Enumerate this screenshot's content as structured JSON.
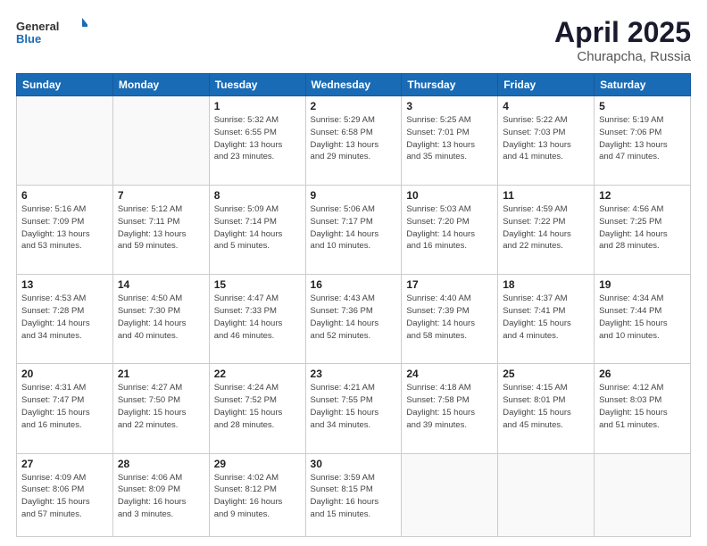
{
  "header": {
    "logo_general": "General",
    "logo_blue": "Blue",
    "title": "April 2025",
    "location": "Churapcha, Russia"
  },
  "weekdays": [
    "Sunday",
    "Monday",
    "Tuesday",
    "Wednesday",
    "Thursday",
    "Friday",
    "Saturday"
  ],
  "weeks": [
    [
      {
        "day": "",
        "detail": ""
      },
      {
        "day": "",
        "detail": ""
      },
      {
        "day": "1",
        "detail": "Sunrise: 5:32 AM\nSunset: 6:55 PM\nDaylight: 13 hours\nand 23 minutes."
      },
      {
        "day": "2",
        "detail": "Sunrise: 5:29 AM\nSunset: 6:58 PM\nDaylight: 13 hours\nand 29 minutes."
      },
      {
        "day": "3",
        "detail": "Sunrise: 5:25 AM\nSunset: 7:01 PM\nDaylight: 13 hours\nand 35 minutes."
      },
      {
        "day": "4",
        "detail": "Sunrise: 5:22 AM\nSunset: 7:03 PM\nDaylight: 13 hours\nand 41 minutes."
      },
      {
        "day": "5",
        "detail": "Sunrise: 5:19 AM\nSunset: 7:06 PM\nDaylight: 13 hours\nand 47 minutes."
      }
    ],
    [
      {
        "day": "6",
        "detail": "Sunrise: 5:16 AM\nSunset: 7:09 PM\nDaylight: 13 hours\nand 53 minutes."
      },
      {
        "day": "7",
        "detail": "Sunrise: 5:12 AM\nSunset: 7:11 PM\nDaylight: 13 hours\nand 59 minutes."
      },
      {
        "day": "8",
        "detail": "Sunrise: 5:09 AM\nSunset: 7:14 PM\nDaylight: 14 hours\nand 5 minutes."
      },
      {
        "day": "9",
        "detail": "Sunrise: 5:06 AM\nSunset: 7:17 PM\nDaylight: 14 hours\nand 10 minutes."
      },
      {
        "day": "10",
        "detail": "Sunrise: 5:03 AM\nSunset: 7:20 PM\nDaylight: 14 hours\nand 16 minutes."
      },
      {
        "day": "11",
        "detail": "Sunrise: 4:59 AM\nSunset: 7:22 PM\nDaylight: 14 hours\nand 22 minutes."
      },
      {
        "day": "12",
        "detail": "Sunrise: 4:56 AM\nSunset: 7:25 PM\nDaylight: 14 hours\nand 28 minutes."
      }
    ],
    [
      {
        "day": "13",
        "detail": "Sunrise: 4:53 AM\nSunset: 7:28 PM\nDaylight: 14 hours\nand 34 minutes."
      },
      {
        "day": "14",
        "detail": "Sunrise: 4:50 AM\nSunset: 7:30 PM\nDaylight: 14 hours\nand 40 minutes."
      },
      {
        "day": "15",
        "detail": "Sunrise: 4:47 AM\nSunset: 7:33 PM\nDaylight: 14 hours\nand 46 minutes."
      },
      {
        "day": "16",
        "detail": "Sunrise: 4:43 AM\nSunset: 7:36 PM\nDaylight: 14 hours\nand 52 minutes."
      },
      {
        "day": "17",
        "detail": "Sunrise: 4:40 AM\nSunset: 7:39 PM\nDaylight: 14 hours\nand 58 minutes."
      },
      {
        "day": "18",
        "detail": "Sunrise: 4:37 AM\nSunset: 7:41 PM\nDaylight: 15 hours\nand 4 minutes."
      },
      {
        "day": "19",
        "detail": "Sunrise: 4:34 AM\nSunset: 7:44 PM\nDaylight: 15 hours\nand 10 minutes."
      }
    ],
    [
      {
        "day": "20",
        "detail": "Sunrise: 4:31 AM\nSunset: 7:47 PM\nDaylight: 15 hours\nand 16 minutes."
      },
      {
        "day": "21",
        "detail": "Sunrise: 4:27 AM\nSunset: 7:50 PM\nDaylight: 15 hours\nand 22 minutes."
      },
      {
        "day": "22",
        "detail": "Sunrise: 4:24 AM\nSunset: 7:52 PM\nDaylight: 15 hours\nand 28 minutes."
      },
      {
        "day": "23",
        "detail": "Sunrise: 4:21 AM\nSunset: 7:55 PM\nDaylight: 15 hours\nand 34 minutes."
      },
      {
        "day": "24",
        "detail": "Sunrise: 4:18 AM\nSunset: 7:58 PM\nDaylight: 15 hours\nand 39 minutes."
      },
      {
        "day": "25",
        "detail": "Sunrise: 4:15 AM\nSunset: 8:01 PM\nDaylight: 15 hours\nand 45 minutes."
      },
      {
        "day": "26",
        "detail": "Sunrise: 4:12 AM\nSunset: 8:03 PM\nDaylight: 15 hours\nand 51 minutes."
      }
    ],
    [
      {
        "day": "27",
        "detail": "Sunrise: 4:09 AM\nSunset: 8:06 PM\nDaylight: 15 hours\nand 57 minutes."
      },
      {
        "day": "28",
        "detail": "Sunrise: 4:06 AM\nSunset: 8:09 PM\nDaylight: 16 hours\nand 3 minutes."
      },
      {
        "day": "29",
        "detail": "Sunrise: 4:02 AM\nSunset: 8:12 PM\nDaylight: 16 hours\nand 9 minutes."
      },
      {
        "day": "30",
        "detail": "Sunrise: 3:59 AM\nSunset: 8:15 PM\nDaylight: 16 hours\nand 15 minutes."
      },
      {
        "day": "",
        "detail": ""
      },
      {
        "day": "",
        "detail": ""
      },
      {
        "day": "",
        "detail": ""
      }
    ]
  ]
}
